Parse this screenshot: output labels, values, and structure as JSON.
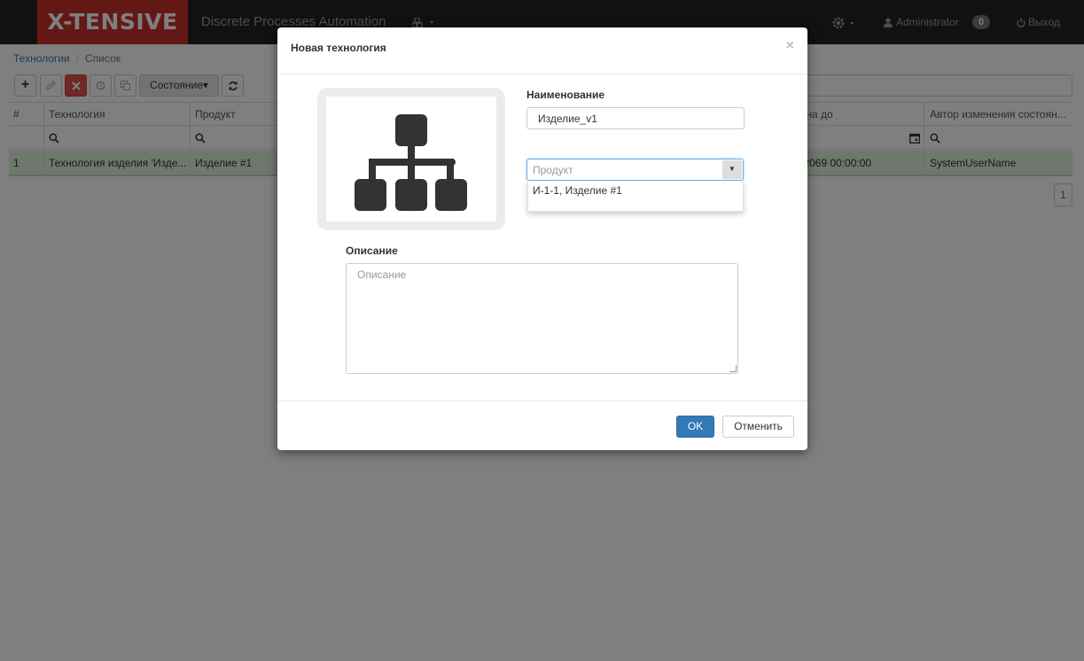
{
  "navbar": {
    "brand": "X-TENSIVE",
    "app_title": "Discrete Processes Automation",
    "modules_icon": "cubes-icon",
    "settings_icon": "gear-icon",
    "user_icon": "user-icon",
    "user": "Administrator",
    "notifications": "0",
    "logout_icon": "power-icon",
    "logout": "Выход"
  },
  "breadcrumb": {
    "root": "Технологии",
    "current": "Список"
  },
  "toolbar": {
    "add": "+",
    "state_button": "Состояние"
  },
  "grid": {
    "columns": {
      "num": "#",
      "technology": "Технология",
      "product": "Продукт",
      "valid_to": "вна до",
      "author": "Автор изменения состоян..."
    },
    "rows": [
      {
        "num": "1",
        "technology": "Технология изделия 'Изде...",
        "product": "Изделие #1",
        "valid_to": ".2069 00:00:00",
        "author": "SystemUserName"
      }
    ],
    "page": "1"
  },
  "modal": {
    "title": "Новая технология",
    "close": "×",
    "image_icon": "sitemap-icon",
    "name_label": "Наименование",
    "name_value": "Изделие_v1",
    "product_placeholder": "Продукт",
    "product_options": [
      "И-1-1, Изделие #1"
    ],
    "description_label": "Описание",
    "description_placeholder": "Описание",
    "ok": "OK",
    "cancel": "Отменить"
  },
  "colors": {
    "brand": "#c9302c",
    "navbar": "#222222",
    "primary": "#337ab7",
    "selected_row": "#dff0d8",
    "danger": "#d9534f"
  }
}
